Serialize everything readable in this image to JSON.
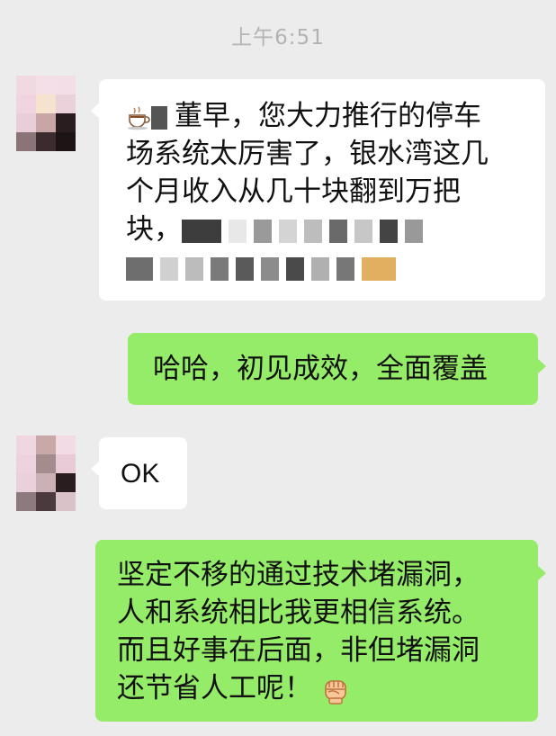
{
  "chat": {
    "timestamp": "上午6:51",
    "messages": [
      {
        "side": "left",
        "lines": [
          "董早，您大力推行的停车",
          "场系统太厉害了，银水湾这几",
          "个月收入从几十块翻到万把",
          "块，"
        ]
      },
      {
        "side": "right",
        "lines": [
          "哈哈，初见成效，全面覆盖"
        ]
      },
      {
        "side": "left",
        "lines": [
          "OK"
        ]
      },
      {
        "side": "right",
        "lines": [
          "坚定不移的通过技术堵漏洞，",
          "人和系统相比我更相信系统。",
          "而且好事在后面，非但堵漏洞",
          "还节省人工呢！"
        ]
      }
    ]
  },
  "icons": {
    "coffee": "coffee-cup-icon",
    "fist": "fist-icon"
  },
  "colors": {
    "background": "#ececec",
    "incoming_bubble": "#ffffff",
    "outgoing_bubble": "#95ec69",
    "timestamp": "#b3b3b3"
  }
}
